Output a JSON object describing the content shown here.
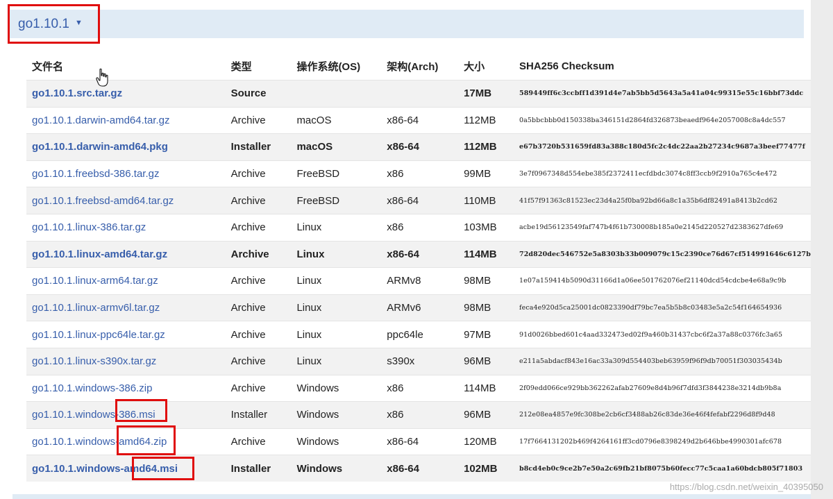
{
  "version": {
    "label": "go1.10.1",
    "caret": "▼"
  },
  "table": {
    "headers": {
      "filename": "文件名",
      "kind": "类型",
      "os": "操作系统(OS)",
      "arch": "架构(Arch)",
      "size": "大小",
      "checksum": "SHA256 Checksum"
    },
    "rows": [
      {
        "filename": "go1.10.1.src.tar.gz",
        "kind": "Source",
        "os": "",
        "arch": "",
        "size": "17MB",
        "checksum": "589449ff6c3ccbff1d391d4e7ab5bb5d5643a5a41a04c99315e55c16bbf73ddc"
      },
      {
        "filename": "go1.10.1.darwin-amd64.tar.gz",
        "kind": "Archive",
        "os": "macOS",
        "arch": "x86-64",
        "size": "112MB",
        "checksum": "0a5bbcbbb0d150338ba346151d2864fd326873beaedf964e2057008c8a4dc557"
      },
      {
        "filename": "go1.10.1.darwin-amd64.pkg",
        "kind": "Installer",
        "os": "macOS",
        "arch": "x86-64",
        "size": "112MB",
        "checksum": "e67b3720b531659fd83a388c180d5fc2c4dc22aa2b27234c9687a3beef77477f"
      },
      {
        "filename": "go1.10.1.freebsd-386.tar.gz",
        "kind": "Archive",
        "os": "FreeBSD",
        "arch": "x86",
        "size": "99MB",
        "checksum": "3e7f0967348d554ebe385f2372411ecfdbdc3074c8ff3ccb9f2910a765c4e472"
      },
      {
        "filename": "go1.10.1.freebsd-amd64.tar.gz",
        "kind": "Archive",
        "os": "FreeBSD",
        "arch": "x86-64",
        "size": "110MB",
        "checksum": "41f57f91363c81523ec23d4a25f0ba92bd66a8c1a35b6df82491a8413b2cd62"
      },
      {
        "filename": "go1.10.1.linux-386.tar.gz",
        "kind": "Archive",
        "os": "Linux",
        "arch": "x86",
        "size": "103MB",
        "checksum": "acbe19d56123549faf747b4f61b730008b185a0e2145d220527d2383627dfe69"
      },
      {
        "filename": "go1.10.1.linux-amd64.tar.gz",
        "kind": "Archive",
        "os": "Linux",
        "arch": "x86-64",
        "size": "114MB",
        "checksum": "72d820dec546752e5a8303b33b009079c15c2390ce76d67cf514991646c6127b"
      },
      {
        "filename": "go1.10.1.linux-arm64.tar.gz",
        "kind": "Archive",
        "os": "Linux",
        "arch": "ARMv8",
        "size": "98MB",
        "checksum": "1e07a159414b5090d31166d1a06ee501762076ef21140dcd54cdcbe4e68a9c9b"
      },
      {
        "filename": "go1.10.1.linux-armv6l.tar.gz",
        "kind": "Archive",
        "os": "Linux",
        "arch": "ARMv6",
        "size": "98MB",
        "checksum": "feca4e920d5ca25001dc0823390df79bc7ea5b5b8c03483e5a2c54f164654936"
      },
      {
        "filename": "go1.10.1.linux-ppc64le.tar.gz",
        "kind": "Archive",
        "os": "Linux",
        "arch": "ppc64le",
        "size": "97MB",
        "checksum": "91d0026bbed601c4aad332473ed02f9a460b31437cbc6f2a37a88c0376fc3a65"
      },
      {
        "filename": "go1.10.1.linux-s390x.tar.gz",
        "kind": "Archive",
        "os": "Linux",
        "arch": "s390x",
        "size": "96MB",
        "checksum": "e211a5abdacf843e16ac33a309d554403beb63959f96f9db70051f303035434b"
      },
      {
        "filename": "go1.10.1.windows-386.zip",
        "kind": "Archive",
        "os": "Windows",
        "arch": "x86",
        "size": "114MB",
        "checksum": "2f09edd066ce929bb362262afab27609e8d4b96f7dfd3f3844238e3214db9b8a"
      },
      {
        "filename": "go1.10.1.windows-386.msi",
        "kind": "Installer",
        "os": "Windows",
        "arch": "x86",
        "size": "96MB",
        "checksum": "212e08ea4857e9fc308be2cb6cf3488ab26c83de36e46f4fefabf2296d8f9d48"
      },
      {
        "filename": "go1.10.1.windows-amd64.zip",
        "kind": "Archive",
        "os": "Windows",
        "arch": "x86-64",
        "size": "120MB",
        "checksum": "17f7664131202b469f4264161ff3cd0796e8398249d2b646bbe4990301afc678"
      },
      {
        "filename": "go1.10.1.windows-amd64.msi",
        "kind": "Installer",
        "os": "Windows",
        "arch": "x86-64",
        "size": "102MB",
        "checksum": "b8cd4eb0c9ce2b7e50a2c69fb21bf8075b60fecc77c5caa1a60bdcb805f71803"
      }
    ],
    "highlighted": [
      0,
      2,
      6,
      14
    ]
  },
  "watermark": "https://blog.csdn.net/weixin_40395050",
  "colors": {
    "link": "#375eab",
    "version_bar": "#e0ebf5",
    "annotation": "#e00d0d"
  }
}
